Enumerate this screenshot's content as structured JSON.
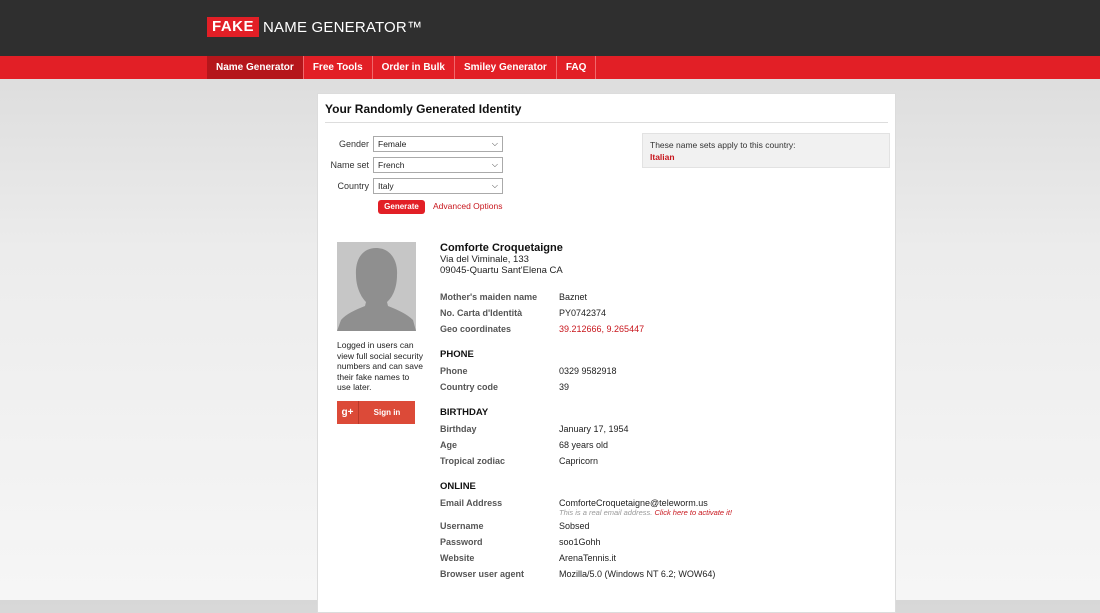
{
  "header": {
    "logo_fake": "FAKE",
    "logo_rest": "NAME GENERATOR™"
  },
  "nav": [
    {
      "label": "Name Generator",
      "active": true
    },
    {
      "label": "Free Tools"
    },
    {
      "label": "Order in Bulk"
    },
    {
      "label": "Smiley Generator"
    },
    {
      "label": "FAQ"
    }
  ],
  "panel": {
    "title": "Your Randomly Generated Identity"
  },
  "form": {
    "gender_label": "Gender",
    "gender_value": "Female",
    "nameset_label": "Name set",
    "nameset_value": "French",
    "country_label": "Country",
    "country_value": "Italy",
    "generate_label": "Generate",
    "advanced_label": "Advanced Options"
  },
  "info": {
    "text": "These name sets apply to this country:",
    "country": "Italian"
  },
  "sidebar": {
    "note": "Logged in users can view full social security numbers and can save their fake names to use later.",
    "google_icon_text": "g+",
    "signin_label": "Sign in"
  },
  "identity": {
    "name": "Comforte Croquetaigne",
    "address_line1": "Via del Viminale, 133",
    "address_line2": "09045-Quartu Sant'Elena CA",
    "mothers_maiden_label": "Mother's maiden name",
    "mothers_maiden": "Baznet",
    "id_label": "No. Carta d'Identità",
    "id_value": "PY0742374",
    "geo_label": "Geo coordinates",
    "geo_value": "39.212666, 9.265447",
    "phone_heading": "PHONE",
    "phone_label": "Phone",
    "phone_value": "0329 9582918",
    "cc_label": "Country code",
    "cc_value": "39",
    "birthday_heading": "BIRTHDAY",
    "birthday_label": "Birthday",
    "birthday_value": "January 17, 1954",
    "age_label": "Age",
    "age_value": "68 years old",
    "zodiac_label": "Tropical zodiac",
    "zodiac_value": "Capricorn",
    "online_heading": "ONLINE",
    "email_label": "Email Address",
    "email_value": "ComforteCroquetaigne@teleworm.us",
    "email_note": "This is a real email address.",
    "email_activate": "Click here to activate it!",
    "username_label": "Username",
    "username_value": "Sobsed",
    "password_label": "Password",
    "password_value": "soo1Gohh",
    "website_label": "Website",
    "website_value": "ArenaTennis.it",
    "ua_label": "Browser user agent",
    "ua_value": "Mozilla/5.0 (Windows NT 6.2; WOW64)"
  },
  "colors": {
    "brand_red": "#e21f26",
    "dark_bar": "#2f2f2f",
    "link_red": "#c8161d",
    "google_red": "#dc4a38"
  }
}
